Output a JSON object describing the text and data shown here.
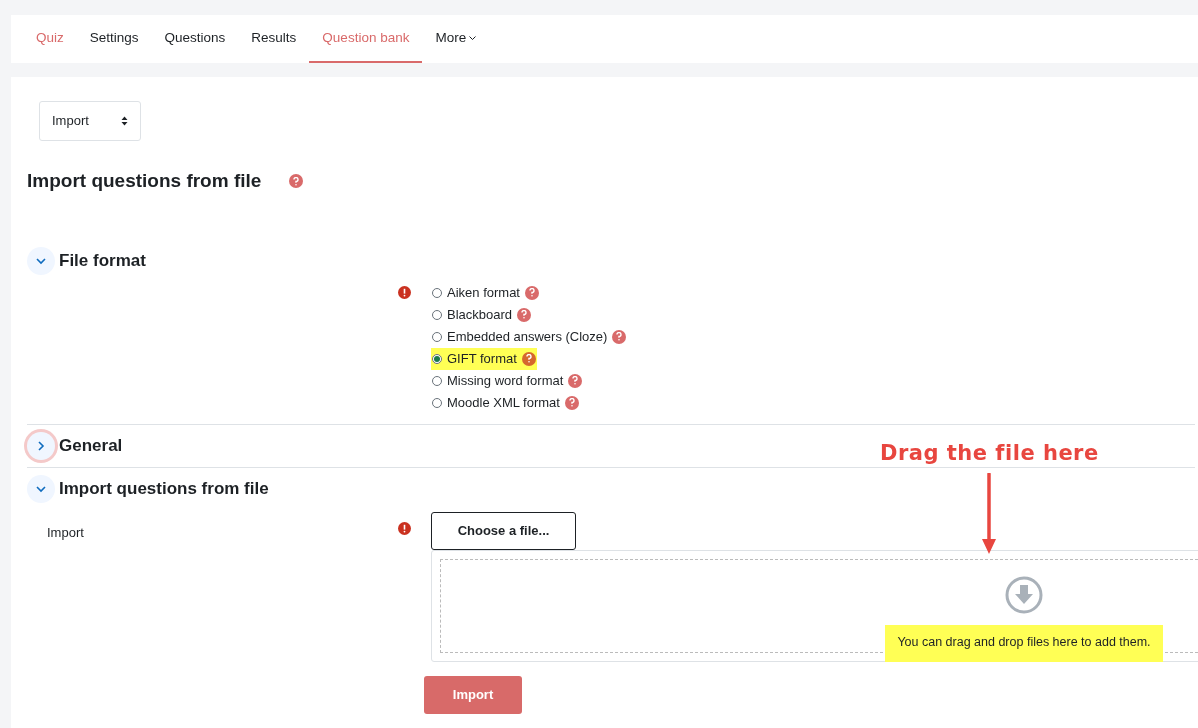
{
  "tabs": [
    {
      "label": "Quiz",
      "selected": false,
      "kind": "home"
    },
    {
      "label": "Settings",
      "selected": false,
      "kind": "tab"
    },
    {
      "label": "Questions",
      "selected": false,
      "kind": "tab"
    },
    {
      "label": "Results",
      "selected": false,
      "kind": "tab"
    },
    {
      "label": "Question bank",
      "selected": true,
      "kind": "tab"
    },
    {
      "label": "More",
      "selected": false,
      "kind": "menu"
    }
  ],
  "action_select": {
    "value": "Import"
  },
  "heading": "Import questions from file",
  "sections": [
    {
      "title": "File format",
      "expanded": true,
      "focused": false,
      "kind": "formats",
      "required": true,
      "options": [
        {
          "label": "Aiken format",
          "selected": false,
          "highlighted": false
        },
        {
          "label": "Blackboard",
          "selected": false,
          "highlighted": false
        },
        {
          "label": "Embedded answers (Cloze)",
          "selected": false,
          "highlighted": false
        },
        {
          "label": "GIFT format",
          "selected": true,
          "highlighted": true
        },
        {
          "label": "Missing word format",
          "selected": false,
          "highlighted": false
        },
        {
          "label": "Moodle XML format",
          "selected": false,
          "highlighted": false
        }
      ]
    },
    {
      "title": "General",
      "expanded": false,
      "focused": true
    },
    {
      "title": "Import questions from file",
      "expanded": true,
      "focused": false,
      "kind": "file",
      "label": "Import",
      "required": true,
      "choose_button": "Choose a file...",
      "dropzone_message": "You can drag and drop files here to add them.",
      "message_highlighted": true
    }
  ],
  "submit_button": "Import",
  "annotation": {
    "text": "Drag the file here"
  }
}
